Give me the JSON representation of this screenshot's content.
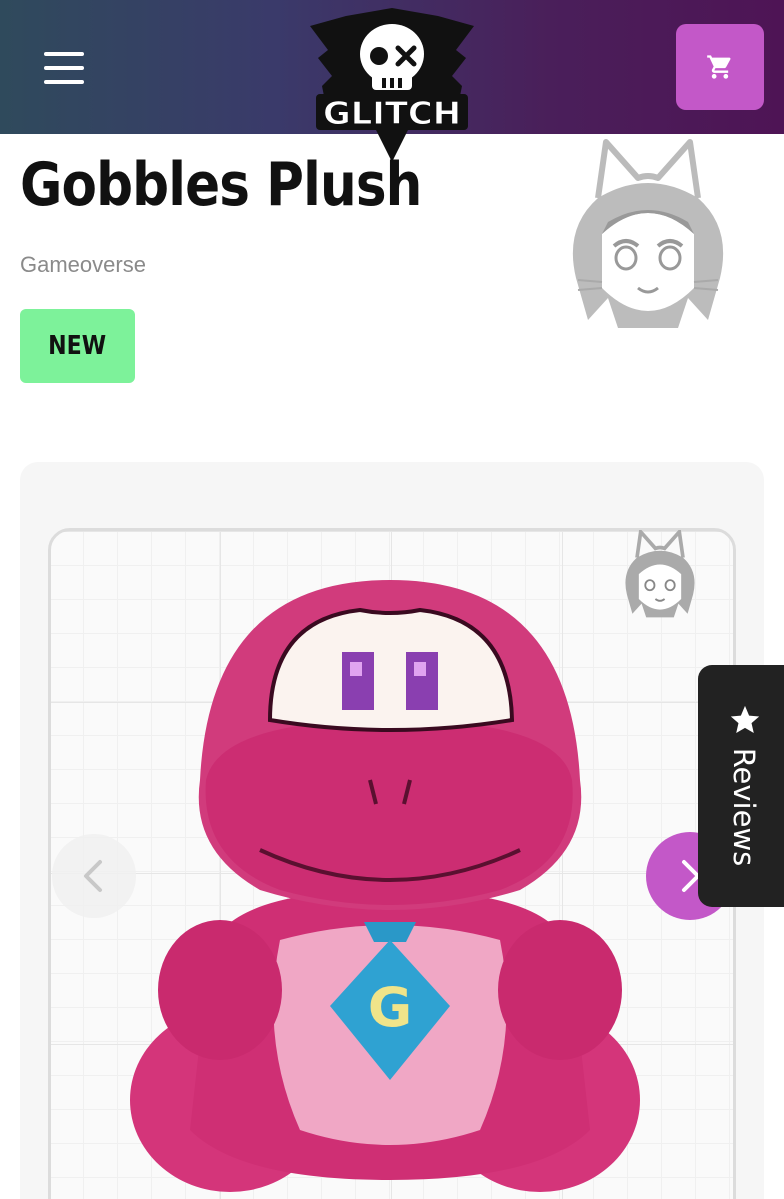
{
  "header": {
    "logo_text": "GLITCH",
    "menu_icon": "hamburger-menu-icon",
    "cart_icon": "shopping-cart-icon",
    "background_colors": [
      "#2f4a5c",
      "#4e1455"
    ],
    "cart_button_color": "#c358c8"
  },
  "product": {
    "title": "Gobbles Plush",
    "brand": "Gameoverse",
    "badge": "NEW",
    "badge_color": "#7df29a"
  },
  "gallery": {
    "prev_icon": "chevron-left-icon",
    "next_icon": "chevron-right-icon",
    "next_button_color": "#c358c8",
    "image_description_icon": "pink-plush-product-photo",
    "monogram": "G"
  },
  "reviews_tab": {
    "label": "Reviews",
    "icon": "star-icon"
  }
}
